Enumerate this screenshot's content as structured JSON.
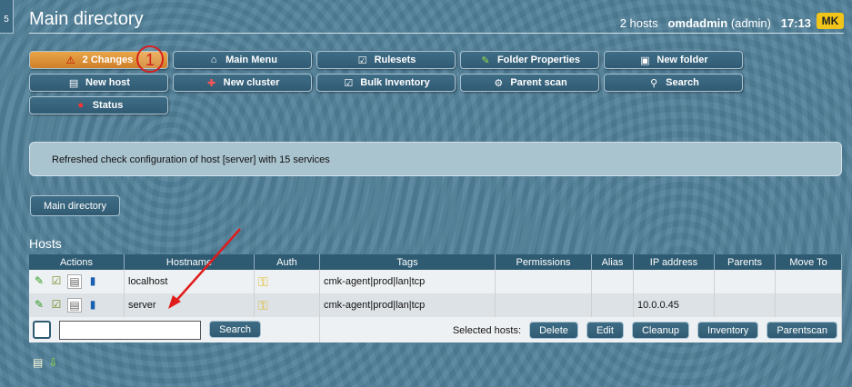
{
  "sidebar_tab": "5",
  "header": {
    "title": "Main directory",
    "hosts_count": "2 hosts",
    "user": "omdadmin",
    "role": "(admin)",
    "time": "17:13",
    "logo": "MK"
  },
  "buttons": [
    {
      "label": "2 Changes",
      "icon": "warning-icon"
    },
    {
      "label": "Main Menu",
      "icon": "home-icon"
    },
    {
      "label": "Rulesets",
      "icon": "rulesets-icon"
    },
    {
      "label": "Folder Properties",
      "icon": "pencil-icon"
    },
    {
      "label": "New folder",
      "icon": "new-folder-icon"
    },
    {
      "label": "New host",
      "icon": "new-host-icon"
    },
    {
      "label": "New cluster",
      "icon": "new-cluster-icon"
    },
    {
      "label": "Bulk Inventory",
      "icon": "inventory-icon"
    },
    {
      "label": "Parent scan",
      "icon": "parent-scan-icon"
    },
    {
      "label": "Search",
      "icon": "search-icon"
    },
    {
      "label": "Status",
      "icon": "traffic-light-icon"
    }
  ],
  "annotation_badge": "1",
  "message": "Refreshed check configuration of host [server] with 15 services",
  "breadcrumb": "Main directory",
  "hosts_section": "Hosts",
  "table": {
    "columns": [
      "Actions",
      "Hostname",
      "Auth",
      "Tags",
      "Permissions",
      "Alias",
      "IP address",
      "Parents",
      "Move To"
    ],
    "rows": [
      {
        "hostname": "localhost",
        "tags": "cmk-agent|prod|lan|tcp",
        "permissions": "",
        "alias": "",
        "ip": "",
        "parents": "",
        "move_to": ""
      },
      {
        "hostname": "server",
        "tags": "cmk-agent|prod|lan|tcp",
        "permissions": "",
        "alias": "",
        "ip": "10.0.0.45",
        "parents": "",
        "move_to": ""
      }
    ]
  },
  "footer": {
    "search_button": "Search",
    "selected_label": "Selected hosts:",
    "actions": [
      "Delete",
      "Edit",
      "Cleanup",
      "Inventory",
      "Parentscan"
    ]
  }
}
